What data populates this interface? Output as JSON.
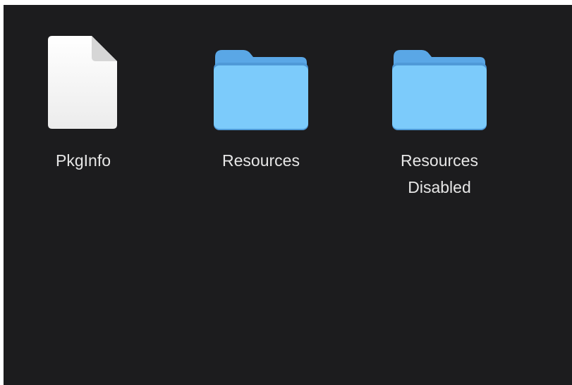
{
  "finder": {
    "items": [
      {
        "name": "PkgInfo",
        "lines": [
          "PkgInfo"
        ],
        "kind": "document-icon"
      },
      {
        "name": "Resources",
        "lines": [
          "Resources"
        ],
        "kind": "folder-icon"
      },
      {
        "name": "Resources Disabled",
        "lines": [
          "Resources",
          "Disabled"
        ],
        "kind": "folder-icon"
      }
    ]
  },
  "colors": {
    "background": "#1c1c1e",
    "folder_front": "#7ccbfb",
    "folder_back": "#5aa7e6",
    "document_page": "#f2f2f2",
    "label_text": "#e6e6e6"
  }
}
